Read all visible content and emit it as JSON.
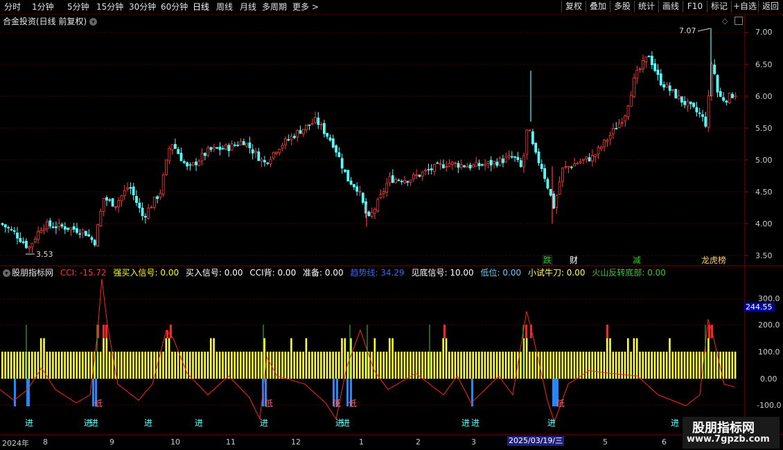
{
  "toolbar": {
    "periods": [
      "分时",
      "1分钟",
      "5分钟",
      "15分钟",
      "30分钟",
      "60分钟",
      "日线",
      "周线",
      "月线",
      "多周期",
      "更多 >"
    ],
    "active_period": "日线",
    "right": [
      "复权",
      "叠加",
      "多股",
      "统计",
      "画线",
      "F10",
      "标记",
      "+自选",
      "返回"
    ]
  },
  "chart_title": "合金投资(日线 前复权)",
  "price_axis": [
    "7.00",
    "6.50",
    "6.00",
    "5.50",
    "5.00",
    "4.50",
    "4.00",
    "3.50"
  ],
  "high_label": "7.07",
  "low_label": "3.53",
  "events": [
    {
      "text": "跌",
      "color": "#33cc33"
    },
    {
      "text": "财",
      "color": "#ffffff"
    },
    {
      "text": "减",
      "color": "#33cc33"
    },
    {
      "text": "龙虎榜",
      "color": "#ffcc66"
    }
  ],
  "indicator": {
    "name": "股朋指标网",
    "items": [
      {
        "text": "CCI: -15.72",
        "color": "#ff3333"
      },
      {
        "text": "强买入信号: 0.00",
        "color": "#ffff00"
      },
      {
        "text": "买入信号: 0.00",
        "color": "#ffffff"
      },
      {
        "text": "CCI背: 0.00",
        "color": "#ffffff"
      },
      {
        "text": "准备: 0.00",
        "color": "#ffffff"
      },
      {
        "text": "趋势线: 34.29",
        "color": "#3366ff"
      },
      {
        "text": "见底信号: 10.00",
        "color": "#ffffff"
      },
      {
        "text": "低位: 0.00",
        "color": "#66ccff"
      },
      {
        "text": "小试牛刀: 0.00",
        "color": "#ffff66"
      },
      {
        "text": "火山反转底部: 0.00",
        "color": "#33cc33"
      }
    ],
    "axis": [
      "300.0",
      "200.0",
      "100.0",
      "0.00",
      "-100.0"
    ],
    "current_value": "244.55",
    "marker_in": "进",
    "marker_low": "低"
  },
  "x_axis": [
    "2024年",
    "8",
    "9",
    "10",
    "11",
    "12",
    "1",
    "2",
    "3",
    "5",
    "6"
  ],
  "crosshair_date": "2025/03/19/三",
  "watermark": {
    "title": "股朋指标网",
    "url": "www.7gpzb.com"
  },
  "chart_data": {
    "type": "candlestick",
    "title": "合金投资(日线 前复权)",
    "ylim": [
      3.4,
      7.2
    ],
    "annotations": {
      "high": 7.07,
      "low": 3.53
    }
  }
}
